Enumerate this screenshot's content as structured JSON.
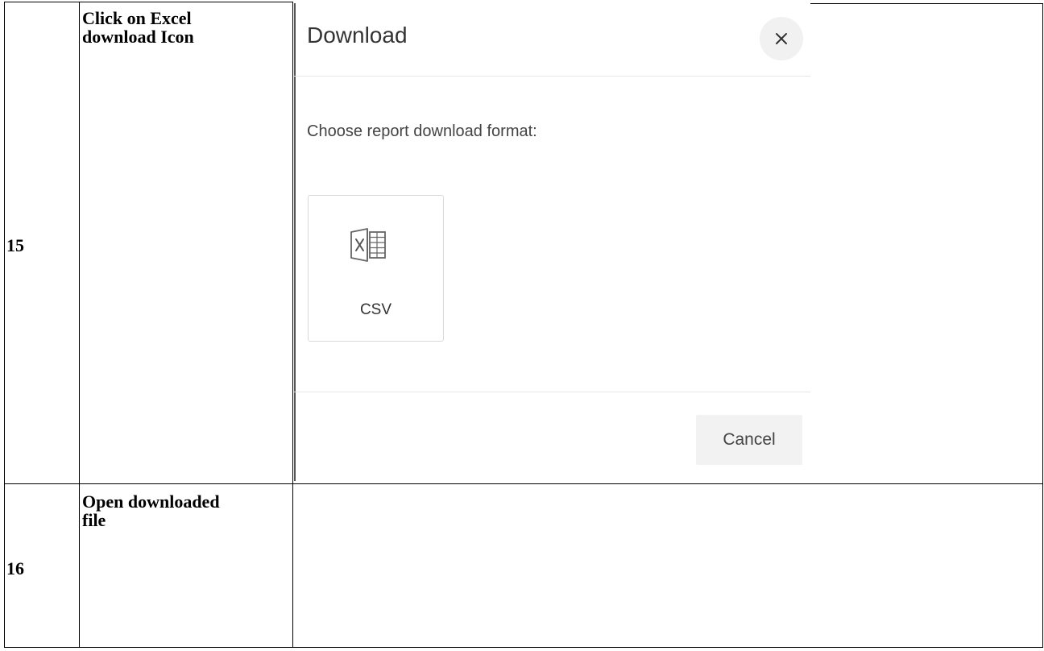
{
  "rows": [
    {
      "number": "15",
      "step_line1": "Click on Excel",
      "step_line2": "download Icon"
    },
    {
      "number": "16",
      "step_line1": "Open downloaded",
      "step_line2": "file"
    }
  ],
  "dialog": {
    "title": "Download",
    "close_icon": "close-icon",
    "prompt": "Choose report download format:",
    "option": {
      "icon": "excel-icon",
      "label": "CSV"
    },
    "cancel_label": "Cancel"
  }
}
